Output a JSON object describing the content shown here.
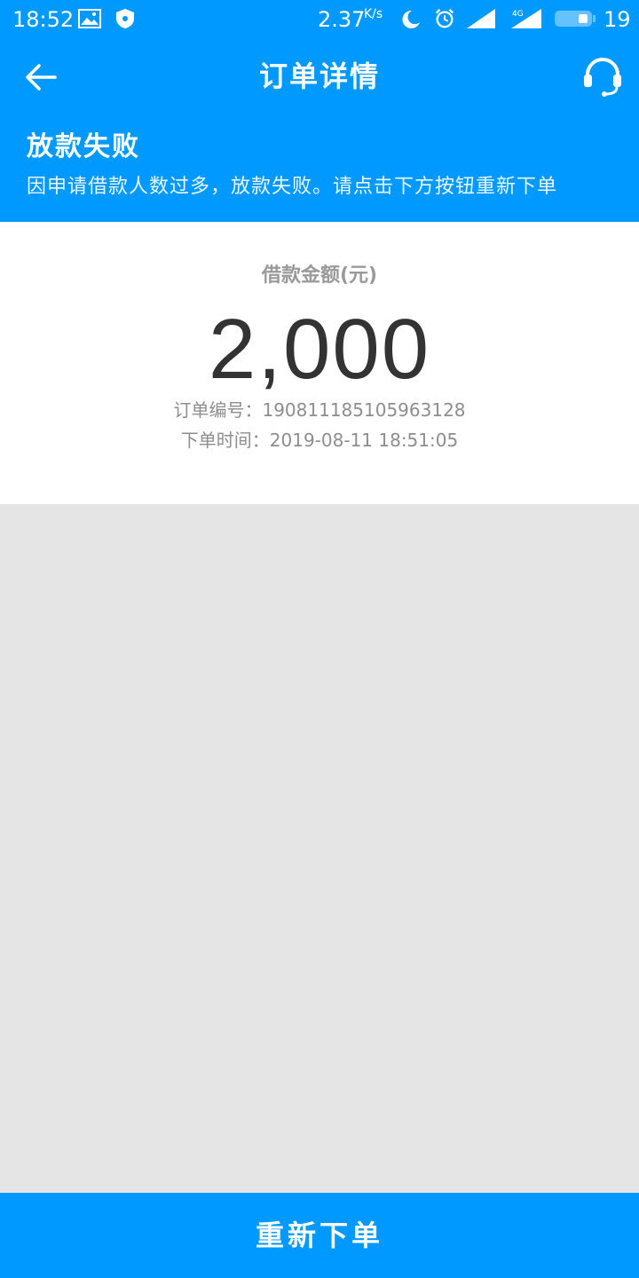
{
  "statusbar": {
    "time": "18:52",
    "net_speed": "2.37",
    "net_speed_unit": "K/s",
    "network": "4G",
    "battery": "19"
  },
  "header": {
    "title": "订单详情"
  },
  "status": {
    "title": "放款失败",
    "message": "因申请借款人数过多，放款失败。请点击下方按钮重新下单"
  },
  "order": {
    "amount_label": "借款金额(元)",
    "amount": "2,000",
    "order_no_label": "订单编号：",
    "order_no": "190811185105963128",
    "order_time_label": "下单时间：",
    "order_time": "2019-08-11 18:51:05"
  },
  "actions": {
    "reorder_label": "重新下单"
  },
  "colors": {
    "primary": "#0099ff",
    "page_background": "#e5e5e5",
    "amount_text": "#333333",
    "secondary_text": "#8e8e8e"
  }
}
